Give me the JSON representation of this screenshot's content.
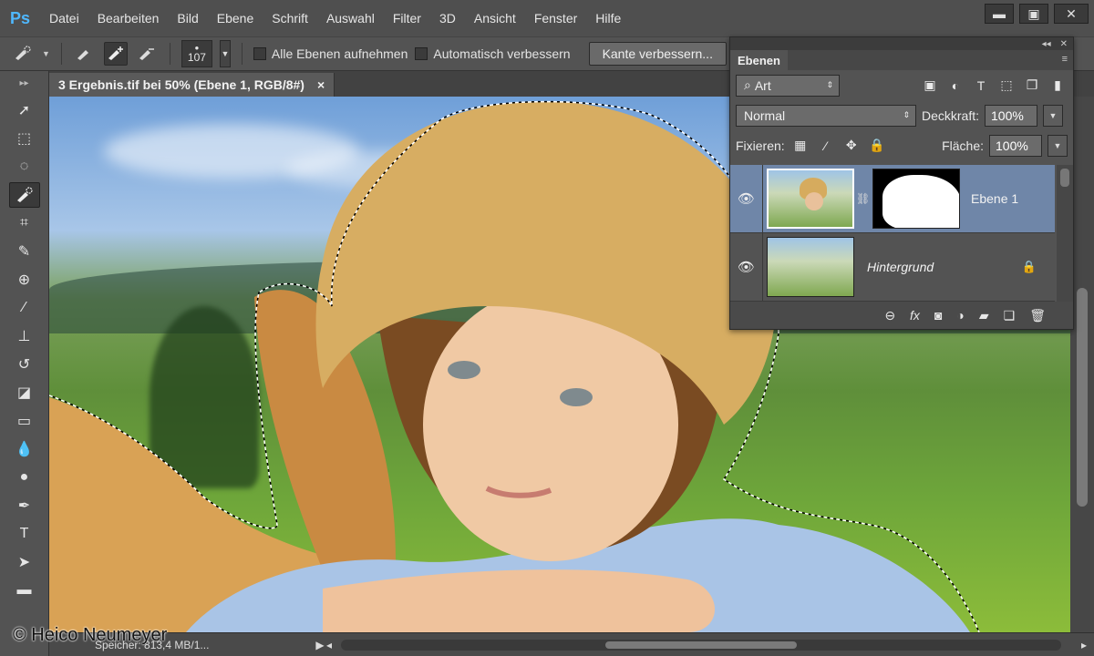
{
  "app": {
    "logo": "Ps"
  },
  "menu": [
    "Datei",
    "Bearbeiten",
    "Bild",
    "Ebene",
    "Schrift",
    "Auswahl",
    "Filter",
    "3D",
    "Ansicht",
    "Fenster",
    "Hilfe"
  ],
  "window_controls": {
    "minimize": "▬",
    "maximize": "▣",
    "close": "✕"
  },
  "options": {
    "brush_size": "107",
    "checkbox_all_layers": "Alle Ebenen aufnehmen",
    "checkbox_auto_enhance": "Automatisch verbessern",
    "refine_edge_button": "Kante verbessern..."
  },
  "document": {
    "tab_title": "3 Ergebnis.tif bei 50% (Ebene 1, RGB/8#)",
    "tab_close": "×"
  },
  "status": {
    "memory": "Speicher: 813,4 MB/1...",
    "watermark": "© Heico Neumeyer"
  },
  "layers_panel": {
    "tab": "Ebenen",
    "filter_kind": "Art",
    "blend_mode": "Normal",
    "opacity_label": "Deckkraft:",
    "opacity_value": "100%",
    "lock_label": "Fixieren:",
    "fill_label": "Fläche:",
    "fill_value": "100%",
    "layers": [
      {
        "name": "Ebene 1",
        "selected": true,
        "has_mask": true,
        "locked": false
      },
      {
        "name": "Hintergrund",
        "selected": false,
        "has_mask": false,
        "locked": true
      }
    ],
    "footer_icons": [
      "link-icon",
      "fx-icon",
      "mask-icon",
      "adjustment-icon",
      "folder-icon",
      "new-layer-icon",
      "trash-icon"
    ],
    "fx_label": "fx"
  },
  "colors": {
    "selected_layer": "#6f86a8",
    "ps_accent": "#4fb8ff"
  }
}
